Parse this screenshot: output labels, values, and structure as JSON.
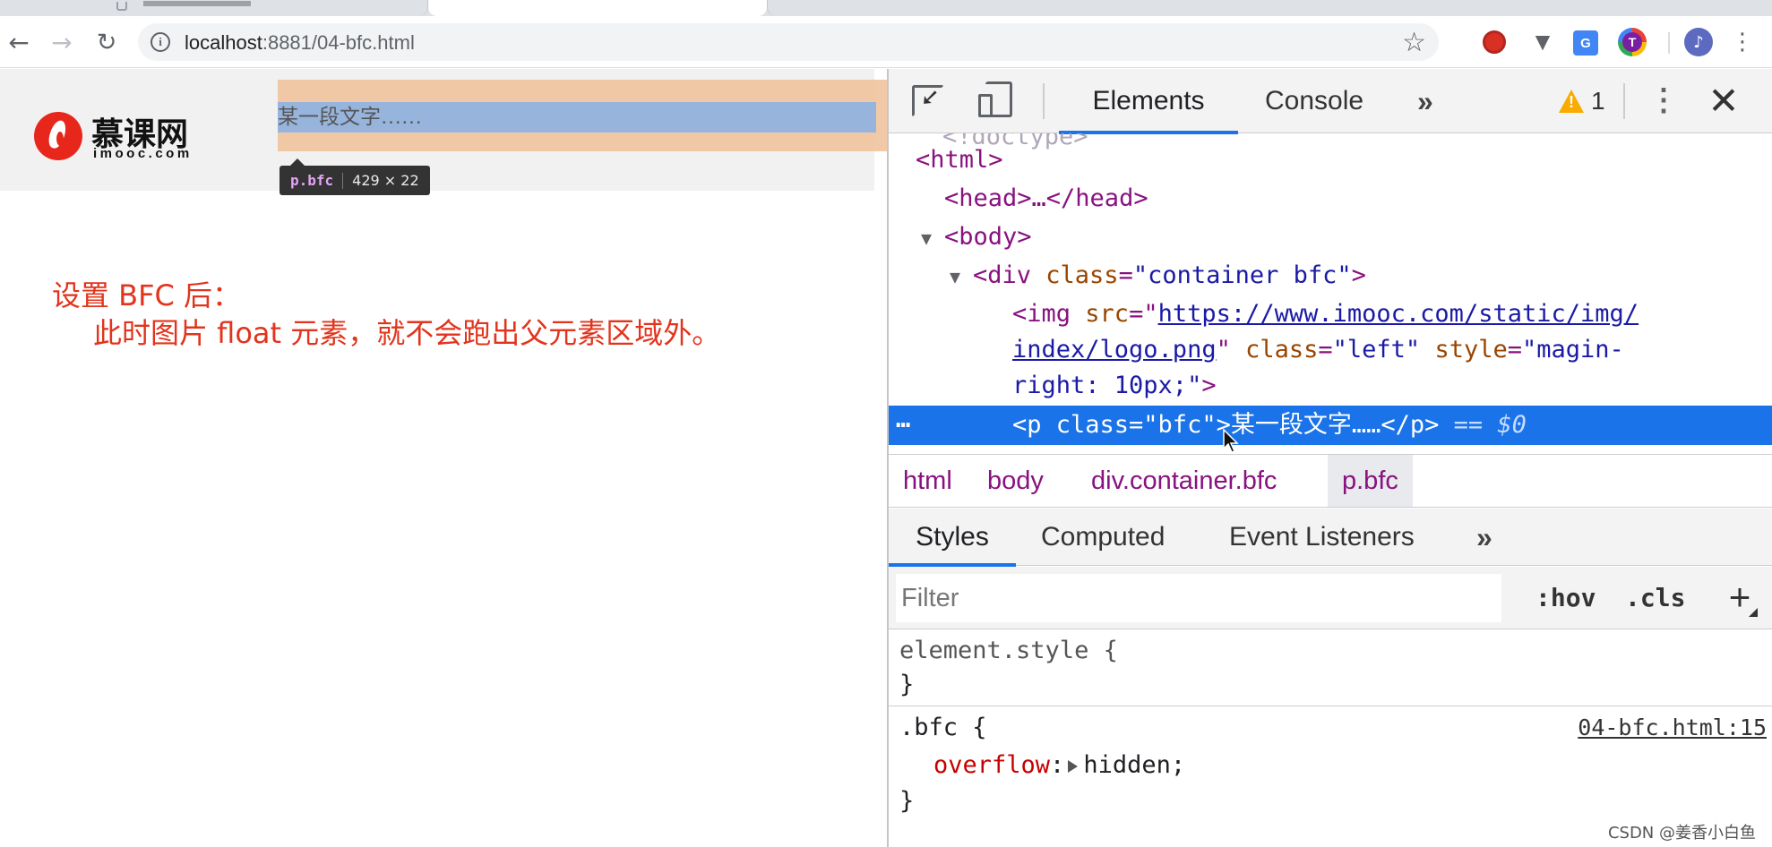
{
  "browser": {
    "url_host": "localhost",
    "url_path": ":8881/04-bfc.html",
    "nav": {
      "back": "←",
      "forward": "→",
      "reload": "↻"
    },
    "star": "☆",
    "extensions": [
      "record",
      "vue",
      "translate",
      "T"
    ],
    "menu": "⋮",
    "profile": "♪"
  },
  "page": {
    "paragraph_text": "某一段文字……",
    "logo_cn": "慕课网",
    "logo_en": "imooc.com",
    "tooltip": {
      "selector": "p.bfc",
      "size": "429 × 22"
    },
    "note_line_1": "设置 BFC 后：",
    "note_line_2": "此时图片 float 元素，就不会跑出父元素区域外。"
  },
  "devtools": {
    "tabs": {
      "elements": "Elements",
      "console": "Console",
      "more": "»"
    },
    "warning_count": "1",
    "menu": "⋮",
    "close": "✕",
    "dom": {
      "html_open": "<html>",
      "head": "<head>…</head>",
      "body_open": "<body>",
      "div_tag": "<div ",
      "div_attr": "class",
      "div_val": "\"container bfc\"",
      "div_close": ">",
      "img_tag": "<img ",
      "img_src_attr": "src",
      "img_src_val_1": "https://www.imooc.com/static/img/",
      "img_src_val_2": "index/logo.png",
      "img_class_attr": "class",
      "img_class_val": "\"left\"",
      "img_style_attr": "style",
      "img_style_val_1": "\"magin-",
      "img_style_val_2": "right: 10px;\"",
      "img_close": ">",
      "selected_html": "<p class=\"bfc\">某一段文字……</p>",
      "selected_eq": "==",
      "selected_ref": "$0",
      "dots": "…"
    },
    "breadcrumbs": [
      "html",
      "body",
      "div.container.bfc",
      "p.bfc"
    ],
    "styles_tabs": {
      "styles": "Styles",
      "computed": "Computed",
      "events": "Event Listeners",
      "more": "»"
    },
    "filter_placeholder": "Filter",
    "hov": ":hov",
    "cls": ".cls",
    "add": "+",
    "rules": {
      "element_selector": "element.style {",
      "close": "}",
      "bfc_selector": ".bfc {",
      "bfc_property": "overflow",
      "bfc_value": "hidden;",
      "bfc_source": "04-bfc.html:15"
    }
  },
  "watermark": "CSDN @姜香小白鱼"
}
